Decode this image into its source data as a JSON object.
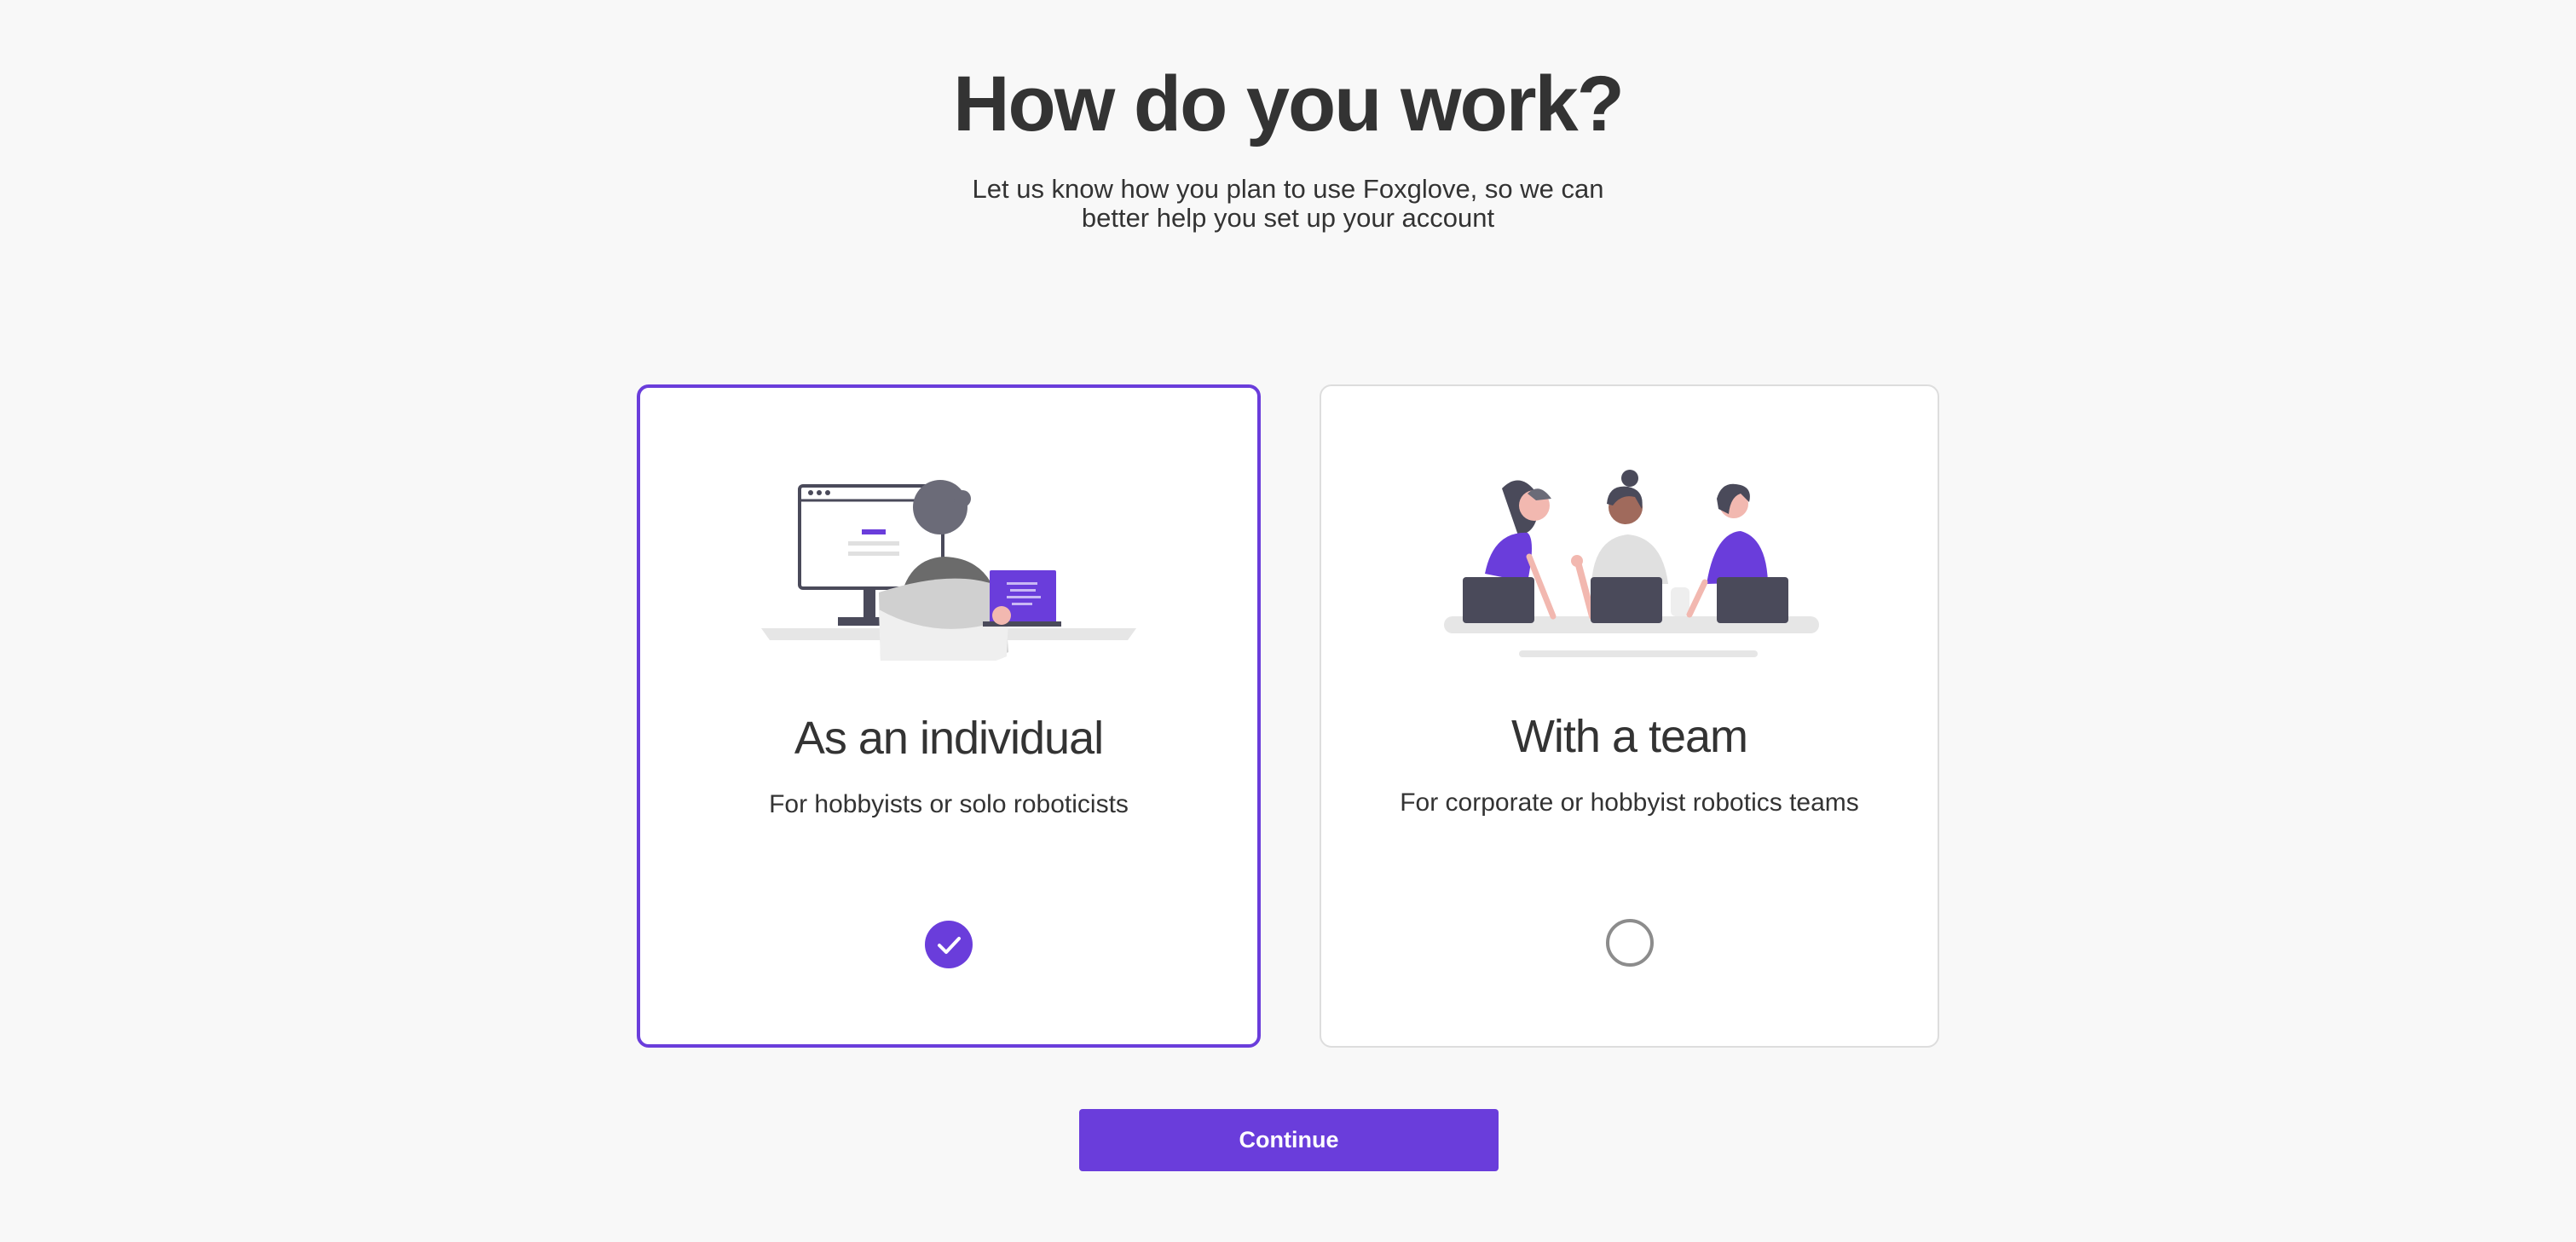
{
  "page": {
    "title": "How do you work?",
    "subtitle": "Let us know how you plan to use Foxglove, so we can better help you set up your account"
  },
  "options": [
    {
      "title": "As an individual",
      "description": "For hobbyists or solo roboticists",
      "selected": true,
      "illustration": "person-at-computer-illustration"
    },
    {
      "title": "With a team",
      "description": "For corporate or hobbyist robotics teams",
      "selected": false,
      "illustration": "team-at-laptops-illustration"
    }
  ],
  "actions": {
    "continue_label": "Continue"
  },
  "colors": {
    "accent": "#6a3ddb",
    "background": "#f8f8f8",
    "text": "#333333",
    "card_border": "#dddddd"
  }
}
